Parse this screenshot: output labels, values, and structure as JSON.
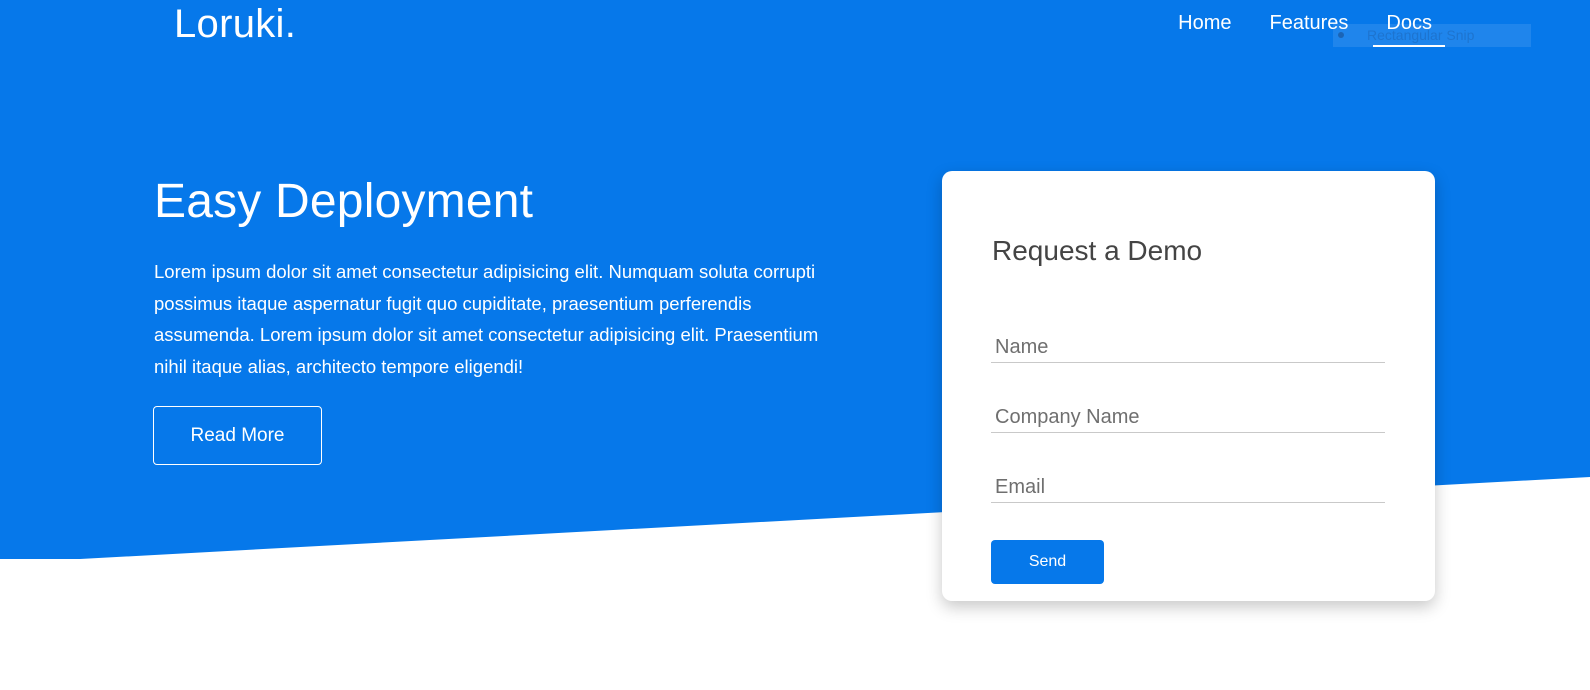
{
  "brand": {
    "logo_text": "Loruki.",
    "accent_color": "#0678ea"
  },
  "nav": {
    "items": [
      {
        "label": "Home",
        "active": false
      },
      {
        "label": "Features",
        "active": false
      },
      {
        "label": "Docs",
        "active": true
      }
    ]
  },
  "overlay": {
    "text": "Rectangular Snip"
  },
  "hero": {
    "title": "Easy Deployment",
    "paragraph": "Lorem ipsum dolor sit amet consectetur adipisicing elit. Numquam soluta corrupti possimus itaque aspernatur fugit quo cupiditate, praesentium perferendis assumenda. Lorem ipsum dolor sit amet consectetur adipisicing elit. Praesentium nihil itaque alias, architecto tempore eligendi!",
    "read_more_label": "Read More"
  },
  "demo_form": {
    "title": "Request a Demo",
    "name_placeholder": "Name",
    "company_placeholder": "Company Name",
    "email_placeholder": "Email",
    "send_label": "Send"
  }
}
